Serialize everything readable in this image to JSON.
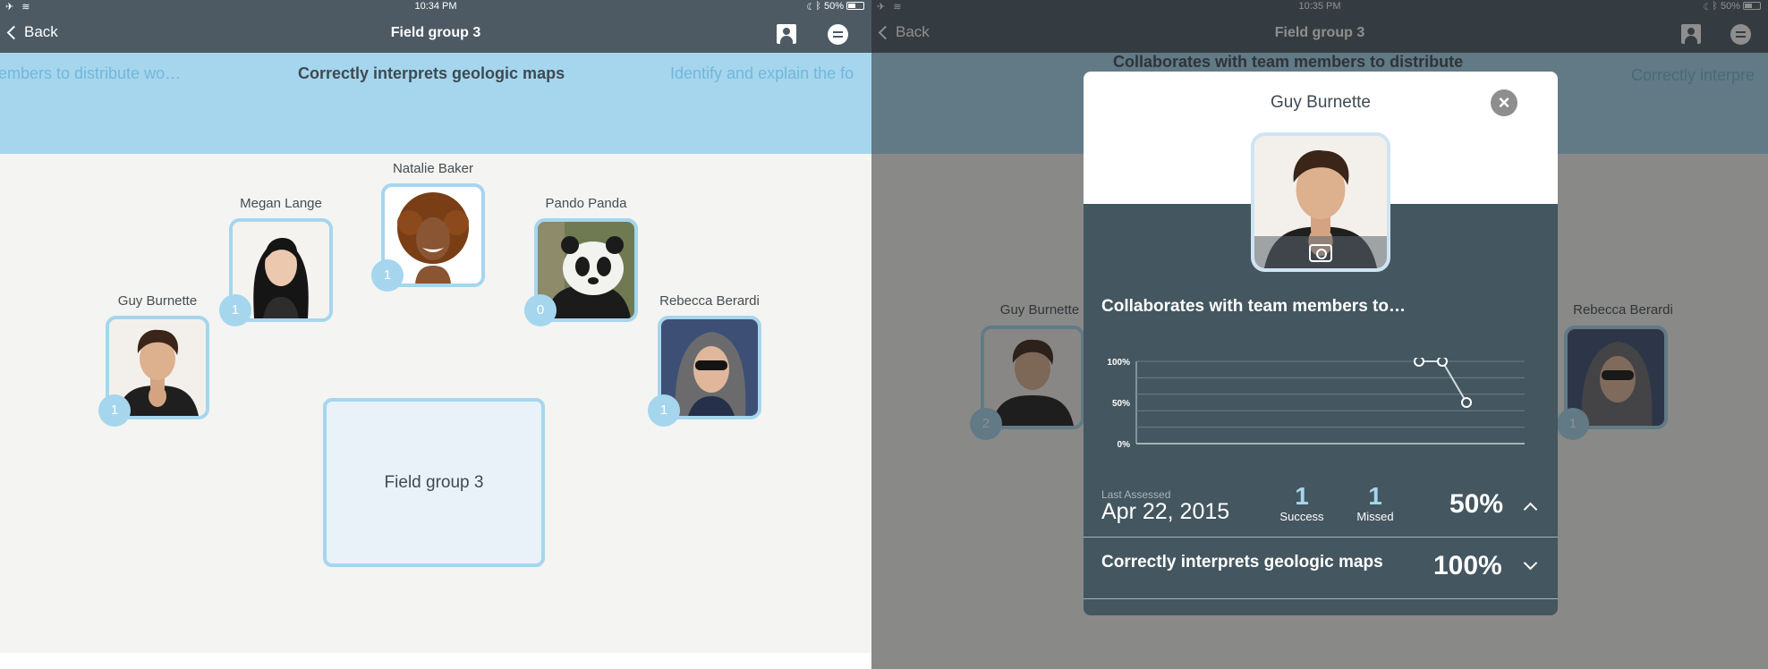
{
  "left": {
    "status": {
      "time": "10:34 PM",
      "battery": "50%"
    },
    "nav": {
      "back": "Back",
      "title": "Field group 3"
    },
    "banner": [
      "embers to distribute wo…",
      "Correctly interprets geologic maps",
      "Identify and explain the fo"
    ],
    "students": [
      {
        "name": "Guy Burnette",
        "count": "1",
        "avatar": "student-guy-photo"
      },
      {
        "name": "Megan Lange",
        "count": "1",
        "avatar": "student-megan-photo"
      },
      {
        "name": "Natalie Baker",
        "count": "1",
        "avatar": "student-natalie-photo"
      },
      {
        "name": "Pando Panda",
        "count": "0",
        "avatar": "panda-photo"
      },
      {
        "name": "Rebecca Berardi",
        "count": "1",
        "avatar": "student-rebecca-photo"
      }
    ],
    "group_label": "Field group 3"
  },
  "right": {
    "status": {
      "time": "10:35 PM",
      "battery": "50%"
    },
    "nav": {
      "back": "Back",
      "title": "Field group 3"
    },
    "banner": [
      "Collaborates with team members to distribute",
      "Correctly interpre"
    ],
    "background_students": [
      {
        "name": "Guy Burnette",
        "count": "2"
      },
      {
        "name": "Rebecca Berardi",
        "count": "1"
      }
    ],
    "modal": {
      "name": "Guy Burnette",
      "close_symbol": "×",
      "objective": "Collaborates with team members to…",
      "chart_data": {
        "type": "line",
        "y_ticks": [
          "100%",
          "50%",
          "0%"
        ],
        "ylim": [
          0,
          100
        ],
        "values": [
          100,
          100,
          50
        ]
      },
      "last_assessed_label": "Last Assessed",
      "last_assessed_date": "Apr 22, 2015",
      "success_count": "1",
      "success_label": "Success",
      "missed_count": "1",
      "missed_label": "Missed",
      "percent": "50%",
      "second_objective": "Correctly interprets geologic maps",
      "second_percent": "100%"
    }
  },
  "colors": {
    "nav": "#4d5a64",
    "accent": "#a5d6ee",
    "modal": "#44565f"
  }
}
